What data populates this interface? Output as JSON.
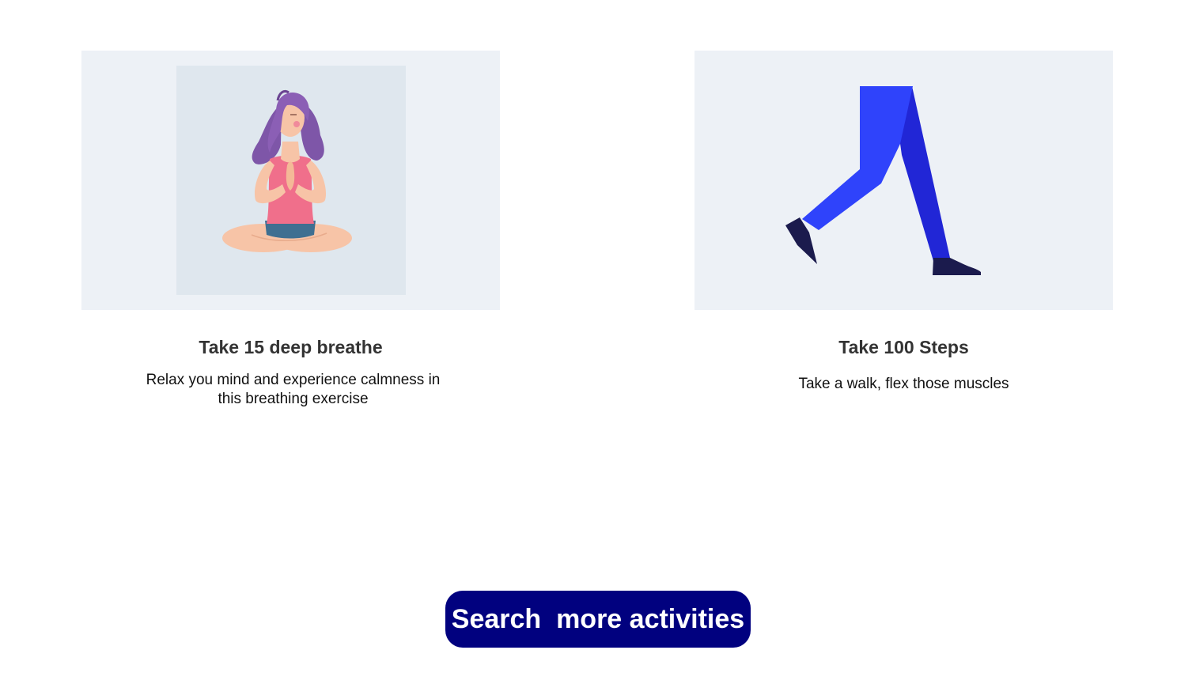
{
  "activities": [
    {
      "title": "Take 15 deep breathe",
      "description": "Relax you mind and experience calmness in this breathing exercise",
      "illustration": "meditating-woman-illustration"
    },
    {
      "title": "Take 100 Steps",
      "description": "Take a walk, flex those muscles",
      "illustration": "walking-legs-illustration"
    }
  ],
  "cta": {
    "label": "Search  more activities"
  },
  "colors": {
    "card_background": "#edf1f6",
    "title_text": "#333333",
    "cta_background": "#01017f",
    "leg_front": "#2f43fb",
    "leg_back": "#2126d6",
    "shoe": "#1b1b4d"
  }
}
